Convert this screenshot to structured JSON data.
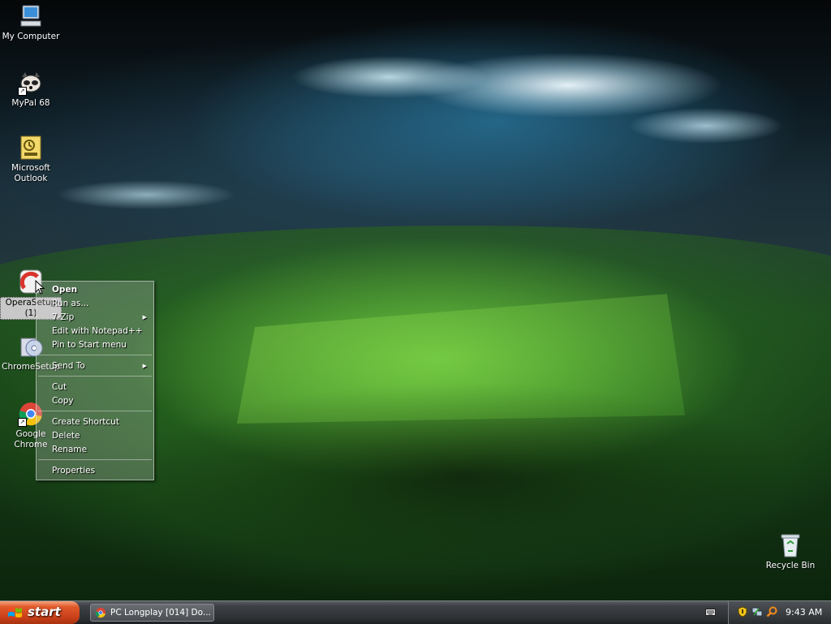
{
  "desktop": {
    "icons": [
      {
        "label": "My Computer"
      },
      {
        "label": "MyPal 68"
      },
      {
        "label": "Microsoft Outlook"
      },
      {
        "label": "OperaSetup (1)"
      },
      {
        "label": "ChromeSetup"
      },
      {
        "label": "Google Chrome"
      },
      {
        "label": "Recycle Bin"
      }
    ]
  },
  "context_menu": {
    "items": [
      {
        "label": "Open"
      },
      {
        "label": "Run as..."
      },
      {
        "label": "7-Zip"
      },
      {
        "label": "Edit with Notepad++"
      },
      {
        "label": "Pin to Start menu"
      },
      {
        "label": "Send To"
      },
      {
        "label": "Cut"
      },
      {
        "label": "Copy"
      },
      {
        "label": "Create Shortcut"
      },
      {
        "label": "Delete"
      },
      {
        "label": "Rename"
      },
      {
        "label": "Properties"
      }
    ]
  },
  "taskbar": {
    "start_label": "start",
    "tasks": [
      {
        "label": "PC Longplay [014] Do...",
        "icon": "chrome-icon"
      }
    ],
    "clock": "9:43 AM"
  },
  "colors": {
    "start_button": "#c9401a",
    "taskbar": "#2c2f32",
    "grass": "#2f7a22"
  }
}
